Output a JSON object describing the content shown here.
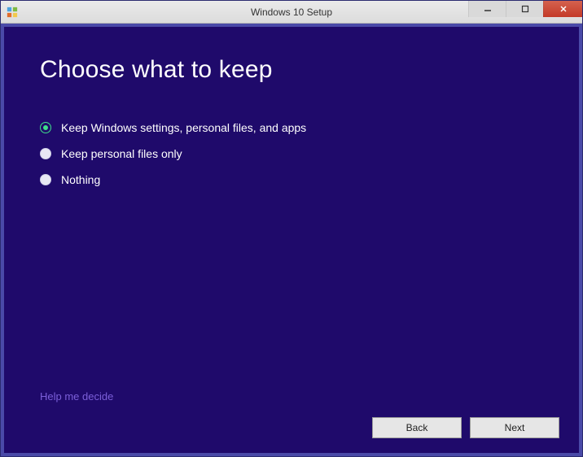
{
  "window": {
    "title": "Windows 10 Setup"
  },
  "heading": "Choose what to keep",
  "options": [
    {
      "label": "Keep Windows settings, personal files, and apps",
      "selected": true
    },
    {
      "label": "Keep personal files only",
      "selected": false
    },
    {
      "label": "Nothing",
      "selected": false
    }
  ],
  "help_link": "Help me decide",
  "buttons": {
    "back": "Back",
    "next": "Next"
  }
}
